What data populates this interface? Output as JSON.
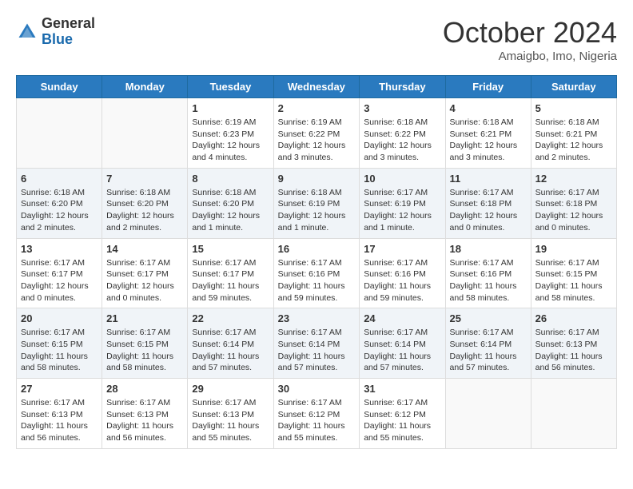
{
  "logo": {
    "general": "General",
    "blue": "Blue"
  },
  "header": {
    "month": "October 2024",
    "location": "Amaigbo, Imo, Nigeria"
  },
  "weekdays": [
    "Sunday",
    "Monday",
    "Tuesday",
    "Wednesday",
    "Thursday",
    "Friday",
    "Saturday"
  ],
  "weeks": [
    [
      {
        "day": "",
        "sunrise": "",
        "sunset": "",
        "daylight": ""
      },
      {
        "day": "",
        "sunrise": "",
        "sunset": "",
        "daylight": ""
      },
      {
        "day": "1",
        "sunrise": "Sunrise: 6:19 AM",
        "sunset": "Sunset: 6:23 PM",
        "daylight": "Daylight: 12 hours and 4 minutes."
      },
      {
        "day": "2",
        "sunrise": "Sunrise: 6:19 AM",
        "sunset": "Sunset: 6:22 PM",
        "daylight": "Daylight: 12 hours and 3 minutes."
      },
      {
        "day": "3",
        "sunrise": "Sunrise: 6:18 AM",
        "sunset": "Sunset: 6:22 PM",
        "daylight": "Daylight: 12 hours and 3 minutes."
      },
      {
        "day": "4",
        "sunrise": "Sunrise: 6:18 AM",
        "sunset": "Sunset: 6:21 PM",
        "daylight": "Daylight: 12 hours and 3 minutes."
      },
      {
        "day": "5",
        "sunrise": "Sunrise: 6:18 AM",
        "sunset": "Sunset: 6:21 PM",
        "daylight": "Daylight: 12 hours and 2 minutes."
      }
    ],
    [
      {
        "day": "6",
        "sunrise": "Sunrise: 6:18 AM",
        "sunset": "Sunset: 6:20 PM",
        "daylight": "Daylight: 12 hours and 2 minutes."
      },
      {
        "day": "7",
        "sunrise": "Sunrise: 6:18 AM",
        "sunset": "Sunset: 6:20 PM",
        "daylight": "Daylight: 12 hours and 2 minutes."
      },
      {
        "day": "8",
        "sunrise": "Sunrise: 6:18 AM",
        "sunset": "Sunset: 6:20 PM",
        "daylight": "Daylight: 12 hours and 1 minute."
      },
      {
        "day": "9",
        "sunrise": "Sunrise: 6:18 AM",
        "sunset": "Sunset: 6:19 PM",
        "daylight": "Daylight: 12 hours and 1 minute."
      },
      {
        "day": "10",
        "sunrise": "Sunrise: 6:17 AM",
        "sunset": "Sunset: 6:19 PM",
        "daylight": "Daylight: 12 hours and 1 minute."
      },
      {
        "day": "11",
        "sunrise": "Sunrise: 6:17 AM",
        "sunset": "Sunset: 6:18 PM",
        "daylight": "Daylight: 12 hours and 0 minutes."
      },
      {
        "day": "12",
        "sunrise": "Sunrise: 6:17 AM",
        "sunset": "Sunset: 6:18 PM",
        "daylight": "Daylight: 12 hours and 0 minutes."
      }
    ],
    [
      {
        "day": "13",
        "sunrise": "Sunrise: 6:17 AM",
        "sunset": "Sunset: 6:17 PM",
        "daylight": "Daylight: 12 hours and 0 minutes."
      },
      {
        "day": "14",
        "sunrise": "Sunrise: 6:17 AM",
        "sunset": "Sunset: 6:17 PM",
        "daylight": "Daylight: 12 hours and 0 minutes."
      },
      {
        "day": "15",
        "sunrise": "Sunrise: 6:17 AM",
        "sunset": "Sunset: 6:17 PM",
        "daylight": "Daylight: 11 hours and 59 minutes."
      },
      {
        "day": "16",
        "sunrise": "Sunrise: 6:17 AM",
        "sunset": "Sunset: 6:16 PM",
        "daylight": "Daylight: 11 hours and 59 minutes."
      },
      {
        "day": "17",
        "sunrise": "Sunrise: 6:17 AM",
        "sunset": "Sunset: 6:16 PM",
        "daylight": "Daylight: 11 hours and 59 minutes."
      },
      {
        "day": "18",
        "sunrise": "Sunrise: 6:17 AM",
        "sunset": "Sunset: 6:16 PM",
        "daylight": "Daylight: 11 hours and 58 minutes."
      },
      {
        "day": "19",
        "sunrise": "Sunrise: 6:17 AM",
        "sunset": "Sunset: 6:15 PM",
        "daylight": "Daylight: 11 hours and 58 minutes."
      }
    ],
    [
      {
        "day": "20",
        "sunrise": "Sunrise: 6:17 AM",
        "sunset": "Sunset: 6:15 PM",
        "daylight": "Daylight: 11 hours and 58 minutes."
      },
      {
        "day": "21",
        "sunrise": "Sunrise: 6:17 AM",
        "sunset": "Sunset: 6:15 PM",
        "daylight": "Daylight: 11 hours and 58 minutes."
      },
      {
        "day": "22",
        "sunrise": "Sunrise: 6:17 AM",
        "sunset": "Sunset: 6:14 PM",
        "daylight": "Daylight: 11 hours and 57 minutes."
      },
      {
        "day": "23",
        "sunrise": "Sunrise: 6:17 AM",
        "sunset": "Sunset: 6:14 PM",
        "daylight": "Daylight: 11 hours and 57 minutes."
      },
      {
        "day": "24",
        "sunrise": "Sunrise: 6:17 AM",
        "sunset": "Sunset: 6:14 PM",
        "daylight": "Daylight: 11 hours and 57 minutes."
      },
      {
        "day": "25",
        "sunrise": "Sunrise: 6:17 AM",
        "sunset": "Sunset: 6:14 PM",
        "daylight": "Daylight: 11 hours and 57 minutes."
      },
      {
        "day": "26",
        "sunrise": "Sunrise: 6:17 AM",
        "sunset": "Sunset: 6:13 PM",
        "daylight": "Daylight: 11 hours and 56 minutes."
      }
    ],
    [
      {
        "day": "27",
        "sunrise": "Sunrise: 6:17 AM",
        "sunset": "Sunset: 6:13 PM",
        "daylight": "Daylight: 11 hours and 56 minutes."
      },
      {
        "day": "28",
        "sunrise": "Sunrise: 6:17 AM",
        "sunset": "Sunset: 6:13 PM",
        "daylight": "Daylight: 11 hours and 56 minutes."
      },
      {
        "day": "29",
        "sunrise": "Sunrise: 6:17 AM",
        "sunset": "Sunset: 6:13 PM",
        "daylight": "Daylight: 11 hours and 55 minutes."
      },
      {
        "day": "30",
        "sunrise": "Sunrise: 6:17 AM",
        "sunset": "Sunset: 6:12 PM",
        "daylight": "Daylight: 11 hours and 55 minutes."
      },
      {
        "day": "31",
        "sunrise": "Sunrise: 6:17 AM",
        "sunset": "Sunset: 6:12 PM",
        "daylight": "Daylight: 11 hours and 55 minutes."
      },
      {
        "day": "",
        "sunrise": "",
        "sunset": "",
        "daylight": ""
      },
      {
        "day": "",
        "sunrise": "",
        "sunset": "",
        "daylight": ""
      }
    ]
  ],
  "shaded_rows": [
    1,
    3
  ]
}
